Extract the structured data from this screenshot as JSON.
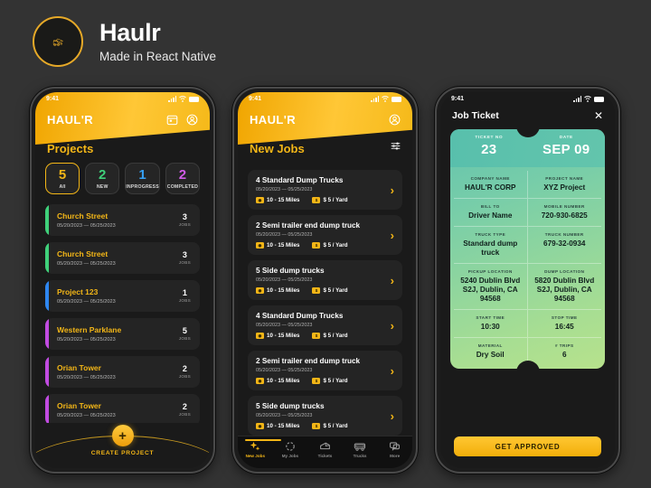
{
  "brand": {
    "title": "Haulr",
    "subtitle": "Made in React Native",
    "logo_icon": "dump-truck-icon",
    "accent": "#F3B617"
  },
  "phone1": {
    "statusbar": {
      "time": "9:41"
    },
    "header": {
      "logo": "HAUL'R",
      "calendar_icon": "calendar-icon",
      "profile_icon": "profile-icon"
    },
    "section_title": "Projects",
    "stats": [
      {
        "num": "5",
        "label": "All",
        "color": "#F3B617",
        "active": true
      },
      {
        "num": "2",
        "label": "NEW",
        "color": "#3FD07A",
        "active": false
      },
      {
        "num": "1",
        "label": "INPROGRESS",
        "color": "#35A0F5",
        "active": false
      },
      {
        "num": "2",
        "label": "COMPLETED",
        "color": "#D15BE8",
        "active": false
      }
    ],
    "projects": [
      {
        "name": "Church Street",
        "dates": "05/20/2023  —  05/25/2023",
        "jobs": "3",
        "jobs_label": "JOBS",
        "accent": "#3FD07A"
      },
      {
        "name": "Church Street",
        "dates": "05/20/2023  —  05/25/2023",
        "jobs": "3",
        "jobs_label": "JOBS",
        "accent": "#3FD07A"
      },
      {
        "name": "Project 123",
        "dates": "05/20/2023  —  05/25/2023",
        "jobs": "1",
        "jobs_label": "JOBS",
        "accent": "#2E86F0"
      },
      {
        "name": "Western Parklane",
        "dates": "05/20/2023  —  05/25/2023",
        "jobs": "5",
        "jobs_label": "JOBS",
        "accent": "#C04BE0"
      },
      {
        "name": "Orian Tower",
        "dates": "05/20/2023  —  05/25/2023",
        "jobs": "2",
        "jobs_label": "JOBS",
        "accent": "#C04BE0"
      },
      {
        "name": "Orian Tower",
        "dates": "05/20/2023  —  05/25/2023",
        "jobs": "2",
        "jobs_label": "JOBS",
        "accent": "#C04BE0"
      }
    ],
    "create": {
      "icon": "plus-icon",
      "label": "CREATE PROJECT"
    }
  },
  "phone2": {
    "statusbar": {
      "time": "9:41"
    },
    "header": {
      "logo": "HAUL'R",
      "profile_icon": "profile-icon"
    },
    "section_title": "New Jobs",
    "filter_icon": "filter-sliders-icon",
    "jobs": [
      {
        "title": "4 Standard Dump Trucks",
        "dates": "05/20/2023  —  05/25/2023",
        "distance": "10 - 15 Miles",
        "rate": "$ 5 / Yard"
      },
      {
        "title": "2 Semi trailer end dump truck",
        "dates": "05/20/2023  —  05/25/2023",
        "distance": "10 - 15 Miles",
        "rate": "$ 5 / Yard"
      },
      {
        "title": "5 Side dump trucks",
        "dates": "05/20/2023  —  05/25/2023",
        "distance": "10 - 15 Miles",
        "rate": "$ 5 / Yard"
      },
      {
        "title": "4 Standard Dump Trucks",
        "dates": "05/20/2023  —  05/25/2023",
        "distance": "10 - 15 Miles",
        "rate": "$ 5 / Yard"
      },
      {
        "title": "2 Semi trailer end dump truck",
        "dates": "05/20/2023  —  05/25/2023",
        "distance": "10 - 15 Miles",
        "rate": "$ 5 / Yard"
      },
      {
        "title": "5 Side dump trucks",
        "dates": "05/20/2023  —  05/25/2023",
        "distance": "10 - 15 Miles",
        "rate": "$ 5 / Yard"
      }
    ],
    "tabs": [
      {
        "label": "New Jobs",
        "icon": "sparkles-icon",
        "active": true
      },
      {
        "label": "My Jobs",
        "icon": "circle-dashed-icon",
        "active": false
      },
      {
        "label": "Tickets",
        "icon": "ticket-icon",
        "active": false
      },
      {
        "label": "Trucks",
        "icon": "truck-icon",
        "active": false
      },
      {
        "label": "More",
        "icon": "chat-icon",
        "active": false
      }
    ]
  },
  "phone3": {
    "statusbar": {
      "time": "9:41"
    },
    "header": {
      "title": "Job Ticket",
      "close_icon": "close-icon"
    },
    "ticket": {
      "ticket_no_label": "TICKET NO",
      "ticket_no": "23",
      "date_label": "DATE",
      "date": "SEP 09",
      "fields": [
        {
          "label": "COMPANY NAME",
          "value": "HAUL'R CORP"
        },
        {
          "label": "PROJECT NAME",
          "value": "XYZ Project"
        },
        {
          "label": "BILL TO",
          "value": "Driver Name"
        },
        {
          "label": "MOBILE NUMBER",
          "value": "720-930-6825"
        },
        {
          "label": "TRUCK TYPE",
          "value": "Standard dump truck"
        },
        {
          "label": "TRUCK NUMBER",
          "value": "679-32-0934"
        },
        {
          "label": "PICKUP LOCATION",
          "value": "5240 Dublin Blvd S2J, Dublin, CA 94568"
        },
        {
          "label": "DUMP LOCATION",
          "value": "5820 Dublin Blvd S2J, Dublin, CA 94568"
        },
        {
          "label": "START TIME",
          "value": "10:30"
        },
        {
          "label": "STOP TIME",
          "value": "16:45"
        },
        {
          "label": "MATERIAL",
          "value": "Dry Soil"
        },
        {
          "label": "# TRIPS",
          "value": "6"
        }
      ]
    },
    "approve_button": "GET APPROVED"
  }
}
